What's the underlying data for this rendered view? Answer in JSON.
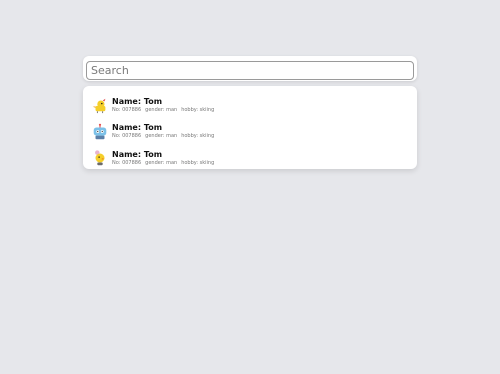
{
  "search": {
    "placeholder": "Search",
    "value": ""
  },
  "results": [
    {
      "name_label": "Name:",
      "name": "Tom",
      "no": "No: 007886",
      "gender": "gender: man",
      "hobby": "hobby: skiing",
      "avatar_icon": "yellow-chick-icon"
    },
    {
      "name_label": "Name:",
      "name": "Tom",
      "no": "No: 007886",
      "gender": "gender: man",
      "hobby": "hobby: skiing",
      "avatar_icon": "blue-robot-icon"
    },
    {
      "name_label": "Name:",
      "name": "Tom",
      "no": "No: 007886",
      "gender": "gender: man",
      "hobby": "hobby: skiing",
      "avatar_icon": "yellow-bird-icon"
    }
  ],
  "colors": {
    "background": "#e6e7eb",
    "card": "#ffffff",
    "avatar_yellow": "#f5cf2a",
    "avatar_blue": "#7cc1e8",
    "avatar_red": "#e24b4b"
  }
}
